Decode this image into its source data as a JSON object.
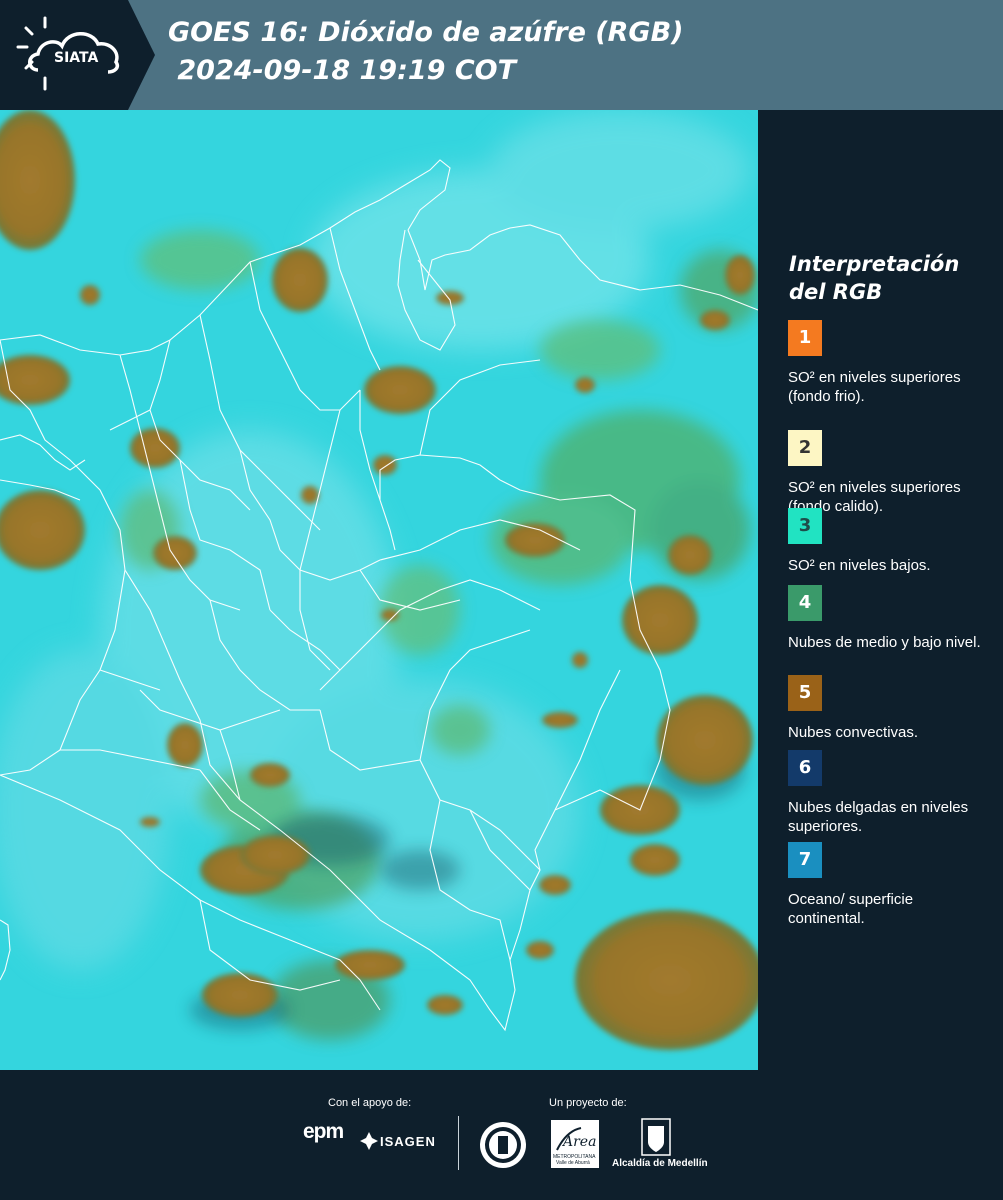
{
  "header": {
    "logo_text": "SIATA",
    "title_line1": "GOES 16: Dióxido de azúfre (RGB)",
    "title_line2": " 2024-09-18 19:19 COT"
  },
  "legend": {
    "title_line1": "Interpretación",
    "title_line2": "del RGB",
    "items": [
      {
        "number": "1",
        "color": "#f47a20",
        "text_color": "#ffffff",
        "text": "SO² en niveles superiores (fondo frio)."
      },
      {
        "number": "2",
        "color": "#fdf6c4",
        "text_color": "#333333",
        "text": "SO² en niveles superiores (fondo calido)."
      },
      {
        "number": "3",
        "color": "#21e3c2",
        "text_color": "#1e4d4a",
        "text": "SO² en niveles bajos."
      },
      {
        "number": "4",
        "color": "#3a9a6a",
        "text_color": "#ffffff",
        "text": "Nubes de medio y bajo nivel."
      },
      {
        "number": "5",
        "color": "#9a6218",
        "text_color": "#ffffff",
        "text": "Nubes convectivas."
      },
      {
        "number": "6",
        "color": "#133a6a",
        "text_color": "#ffffff",
        "text": "Nubes delgadas en niveles superiores."
      },
      {
        "number": "7",
        "color": "#1a8fc0",
        "text_color": "#ffffff",
        "text": "Oceano/ superficie continental."
      }
    ]
  },
  "footer": {
    "support_label": "Con el apoyo de:",
    "project_label": "Un proyecto de:",
    "epm_text": "epm",
    "isagen_text": "ISAGEN",
    "area_text": "Área",
    "metropolitana_text": "METROPOLITANA",
    "valle_text": "Valle de Aburrá",
    "alcaldia_text": "Alcaldía de Medellín"
  },
  "colors": {
    "background": "#0e1f2c",
    "header": "#4d7283",
    "sky": "#33d6df",
    "cloud_convective": "#9a7a30",
    "cloud_mid": "#4caf63"
  }
}
